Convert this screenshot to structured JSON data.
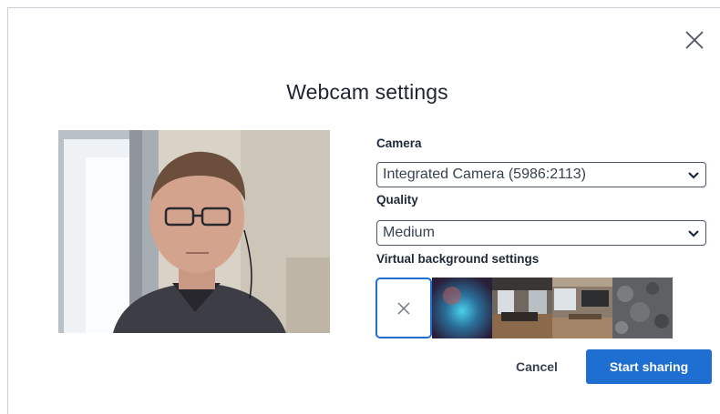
{
  "dialog": {
    "title": "Webcam settings",
    "close_icon": "close-icon"
  },
  "preview": {
    "icon": "webcam-preview"
  },
  "camera": {
    "label": "Camera",
    "selected": "Integrated Camera (5986:2113)"
  },
  "quality": {
    "label": "Quality",
    "selected": "Medium"
  },
  "virtual_background": {
    "label": "Virtual background settings",
    "options": [
      {
        "name": "none",
        "selected": true
      },
      {
        "name": "blur-gradient",
        "selected": false
      },
      {
        "name": "living-room",
        "selected": false
      },
      {
        "name": "kitchen",
        "selected": false
      },
      {
        "name": "stone-texture",
        "selected": false
      }
    ]
  },
  "actions": {
    "cancel": "Cancel",
    "start": "Start sharing"
  },
  "colors": {
    "accent": "#1e6fd1"
  }
}
